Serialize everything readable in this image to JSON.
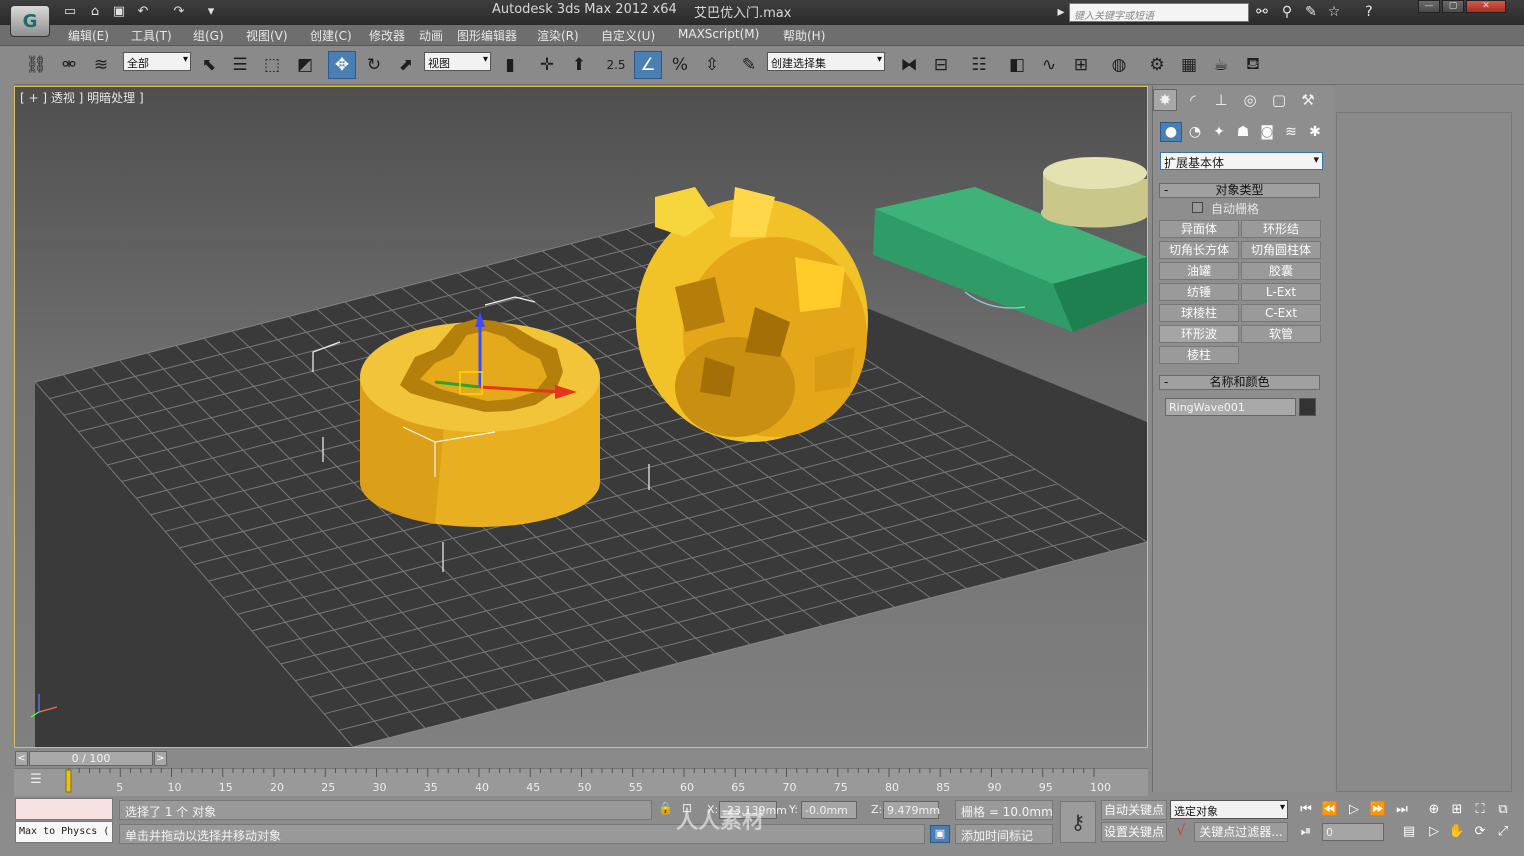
{
  "titlebar": {
    "title": "Autodesk 3ds Max  2012 x64",
    "file": "艾巴优入门.max",
    "search_placeholder": "键入关键字或短语",
    "logo": "app-logo",
    "quick_icons": [
      "new-file-icon",
      "open-file-icon",
      "save-icon",
      "undo-icon",
      "redo-icon",
      "customize-icon"
    ]
  },
  "menu": [
    "编辑(E)",
    "工具(T)",
    "组(G)",
    "视图(V)",
    "创建(C)",
    "修改器",
    "动画",
    "图形编辑器",
    "渲染(R)",
    "自定义(U)",
    "MAXScript(M)",
    "帮助(H)"
  ],
  "toolbar": {
    "selection_filter": "全部",
    "ref_coord": "视图",
    "snap_label": "2.5",
    "named_selection": "创建选择集"
  },
  "viewport": {
    "label": "[ + ] 透视 ] 明暗处理 ]"
  },
  "command_panel": {
    "category": "扩展基本体",
    "object_type_title": "对象类型",
    "autogrid": "自动栅格",
    "buttons": [
      [
        "异面体",
        "环形结"
      ],
      [
        "切角长方体",
        "切角圆柱体"
      ],
      [
        "油罐",
        "胶囊"
      ],
      [
        "纺锤",
        "L-Ext"
      ],
      [
        "球棱柱",
        "C-Ext"
      ],
      [
        "环形波",
        "软管"
      ],
      [
        "棱柱",
        ""
      ]
    ],
    "name_color_title": "名称和颜色",
    "object_name": "RingWave001",
    "object_color": "#333333"
  },
  "timeline": {
    "slider": "0 / 100",
    "ticks": [
      "5",
      "10",
      "15",
      "20",
      "25",
      "30",
      "35",
      "40",
      "45",
      "50",
      "55",
      "60",
      "65",
      "70",
      "75",
      "80",
      "85",
      "90",
      "95",
      "100"
    ]
  },
  "status": {
    "maxscript_mini": "Max to Physcs (",
    "selected": "选择了 1 个 对象",
    "prompt": "单击并拖动以选择并移动对象",
    "x_label": "X:",
    "x_value": "-23.139mm",
    "y_label": "Y:",
    "y_value": "-0.0mm",
    "z_label": "Z:",
    "z_value": "9.479mm",
    "grid": "栅格 = 10.0mm",
    "add_time_tag": "添加时间标记",
    "auto_key": "自动关键点",
    "set_key": "设置关键点",
    "selected_obj": "选定对象",
    "key_filters": "关键点过滤器...",
    "frame": "0"
  },
  "watermark": "人人素材"
}
